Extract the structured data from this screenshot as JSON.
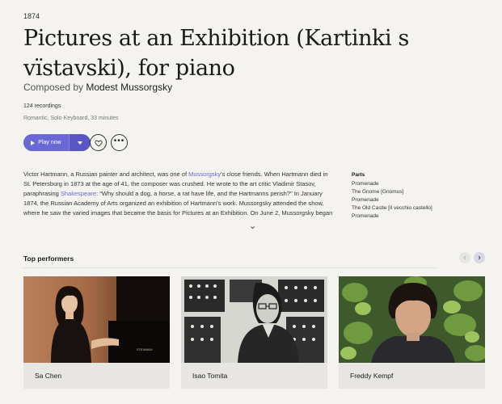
{
  "work": {
    "year": "1874",
    "title": "Pictures at an Exhibition (Kartinki s vïstavski), for piano",
    "composed_by_label": "Composed by",
    "composer": "Modest Mussorgsky",
    "recordings": "124 recordings",
    "tags": "Romantic, Solo Keyboard, 33 minutes"
  },
  "actions": {
    "play_label": "Play now"
  },
  "description": {
    "p1": "Victor Hartmann, a Russian painter and architect, was one of ",
    "link1": "Mussorgsky",
    "p2": "'s close friends. When Hartmann died in St. Petersburg in 1873 at the age of 41, the composer was crushed. He wrote to the art critic Vladimir Stasov, paraphrasing ",
    "link2": "Shakespeare",
    "p3": ": \"Why should a dog, a horse, a rat have life, and the Hartmanns perish?\" In January 1874, the Russian Academy of Arts organized an exhibition of Hartmann's work. Mussorgsky attended the show, where he saw the varied images that became the basis for Pictures at an Exhibition. On June 2, Mussorgsky began work on"
  },
  "parts": {
    "heading": "Parts",
    "items": [
      "Promenade",
      "The Gnome [Gnomus]",
      "Promenade",
      "The Old Castle [Il vecchio castello]",
      "Promenade"
    ]
  },
  "performers": {
    "heading": "Top performers",
    "items": [
      {
        "name": "Sa Chen",
        "photo_text": "STEINWAY"
      },
      {
        "name": "Isao Tomita"
      },
      {
        "name": "Freddy Kempf"
      }
    ]
  },
  "colors": {
    "accent": "#6a67d6",
    "background": "#f4f3f0",
    "card_bar": "#e7e6e3"
  },
  "icons": [
    "play-icon",
    "chevron-down-icon",
    "heart-icon",
    "more-icon",
    "chevron-left-icon",
    "chevron-right-icon"
  ]
}
